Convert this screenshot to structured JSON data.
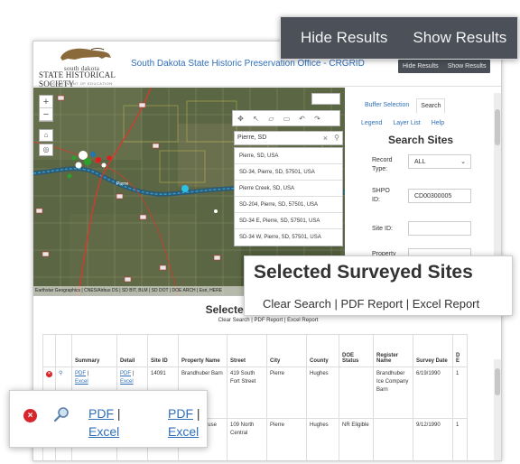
{
  "header": {
    "logo_line1": "south dakota",
    "logo_line2": "STATE HISTORICAL SOCIETY",
    "logo_line3": "DEPARTMENT OF EDUCATION",
    "app_title": "South Dakota State Historic Preservation Office - CRGRID",
    "hide_results": "Hide Results",
    "show_results": "Show Results"
  },
  "map": {
    "attribution": "Earthstar Geographics | CNES/Airbus DS | SD BIT, BLM | SD DOT | DOE ARCH | Esri, HERE",
    "search_value": "Pierre, SD",
    "suggestions": [
      "Pierre, SD, USA",
      "SD-34, Pierre, SD, 57501, USA",
      "Pierre Creek, SD, USA",
      "SD-204, Pierre, SD, 57501, USA",
      "SD-34 E, Pierre, SD, 57501, USA",
      "SD-34 W, Pierre, SD, 57501, USA"
    ]
  },
  "panel": {
    "tab_buffer": "Buffer Selection",
    "tab_search": "Search",
    "link_legend": "Legend",
    "link_layers": "Layer List",
    "link_help": "Help",
    "heading": "Search Sites",
    "record_type_label": "Record Type:",
    "record_type_value": "ALL",
    "shpo_label": "SHPO ID:",
    "shpo_value": "CD00300005",
    "site_label": "Site ID:",
    "property_label": "Property"
  },
  "results": {
    "title": "Selected Surveyed Sites",
    "clear": "Clear Search",
    "pdf_report": "PDF Report",
    "excel_report": "Excel Report",
    "columns": [
      "",
      "",
      "Summary",
      "Detail",
      "Site ID",
      "Property Name",
      "Street",
      "City",
      "County",
      "DOE Status",
      "Register Name",
      "Survey Date",
      "D E"
    ],
    "rows": [
      {
        "site_id": "14091",
        "property": "Brandhuber Barn",
        "street": "419 South Fort Street",
        "city": "Pierre",
        "county": "Hughes",
        "doe": "",
        "register": "Brandhuber Ice Company Barn",
        "date": "6/19/1990",
        "d": "1"
      },
      {
        "site_id": "",
        "property": "ley, rd M, ouse",
        "street": "109 North Central",
        "city": "Pierre",
        "county": "Hughes",
        "doe": "NR Eligible",
        "register": "",
        "date": "9/12/1990",
        "d": "1"
      }
    ],
    "pdf": "PDF",
    "excel": "Excel"
  },
  "callouts": {
    "hide_results": "Hide Results",
    "show_results": "Show Results",
    "title": "Selected Surveyed Sites",
    "links": "Clear Search | PDF Report | Excel Report",
    "pdf": "PDF",
    "excel": "Excel",
    "sep": " |"
  }
}
